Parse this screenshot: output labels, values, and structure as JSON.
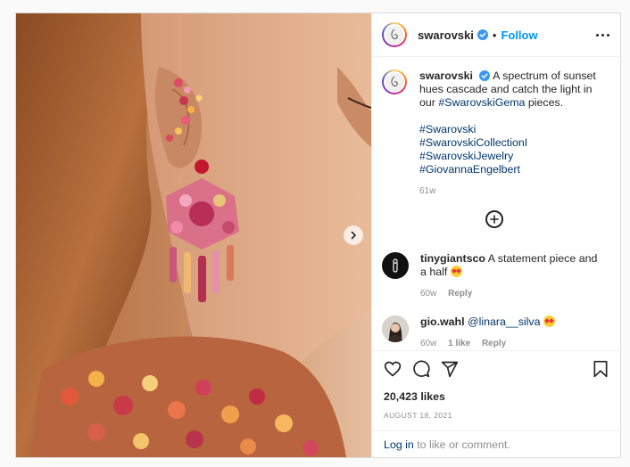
{
  "post": {
    "username": "swarovski",
    "follow_label": "Follow",
    "separator": "•",
    "caption": {
      "username": "swarovski",
      "text_before": "A spectrum of sunset hues cascade and catch the light in our ",
      "inline_tag": "#SwarovskiGema",
      "text_after": " pieces.",
      "hashtags": [
        "#Swarovski",
        "#SwarovskiCollectionI",
        "#SwarovskiJewelry",
        "#GiovannaEngelbert"
      ],
      "age": "61w"
    },
    "comments": [
      {
        "username": "tinygiantsco",
        "text": "A statement piece and a half",
        "emoji": "heart-eyes-emoji",
        "age": "60w",
        "reply_label": "Reply"
      },
      {
        "username": "gio.wahl",
        "mention": "@linara__silva",
        "emoji": "heart-eyes-emoji",
        "age": "60w",
        "likes": "1 like",
        "reply_label": "Reply"
      }
    ],
    "likes_text": "20,423 likes",
    "date": "AUGUST 18, 2021",
    "login_link": "Log in",
    "login_suffix": " to like or comment."
  },
  "icons": [
    "verified-badge-icon",
    "more-options-icon",
    "load-more-comments-icon",
    "chevron-right-icon",
    "heart-icon",
    "comment-icon",
    "share-icon",
    "bookmark-icon"
  ],
  "colors": {
    "accent": "#0095f6",
    "link": "#00376b",
    "muted": "#8e8e8e",
    "border": "#dbdbdb"
  }
}
